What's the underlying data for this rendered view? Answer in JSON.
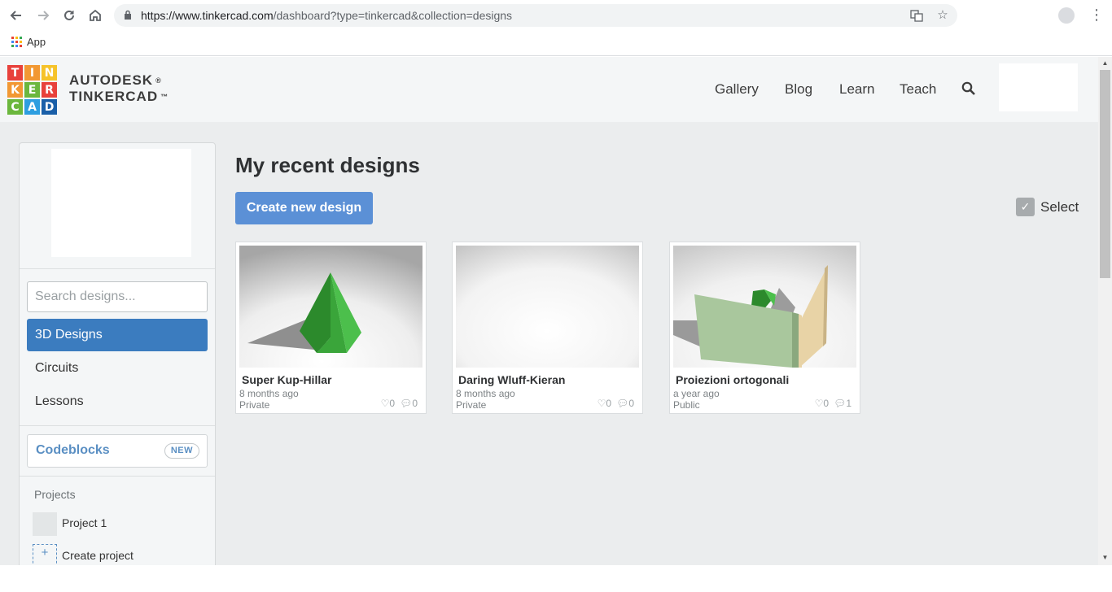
{
  "browser": {
    "url_host": "https://www.tinkercad.com",
    "url_path": "/dashboard?type=tinkercad&collection=designs",
    "bookmark_label": "App"
  },
  "header": {
    "logo_letters": [
      "T",
      "I",
      "N",
      "K",
      "E",
      "R",
      "C",
      "A",
      "D"
    ],
    "logo_colors": [
      "#e8413b",
      "#f29833",
      "#f6c32a",
      "#f29833",
      "#6bb73d",
      "#e8413b",
      "#6bb73d",
      "#2d9ee0",
      "#1a5fa8"
    ],
    "brand_line1": "AUTODESK",
    "brand_mark1": "®",
    "brand_line2": "TINKERCAD",
    "brand_mark2": "™",
    "nav": [
      "Gallery",
      "Blog",
      "Learn",
      "Teach"
    ]
  },
  "sidebar": {
    "search_placeholder": "Search designs...",
    "items": [
      {
        "label": "3D Designs",
        "active": true
      },
      {
        "label": "Circuits",
        "active": false
      },
      {
        "label": "Lessons",
        "active": false
      }
    ],
    "codeblocks_label": "Codeblocks",
    "codeblocks_badge": "NEW",
    "projects_title": "Projects",
    "project_name": "Project 1",
    "create_plus": "+",
    "create_label": "Create project"
  },
  "main": {
    "title": "My recent designs",
    "create_button": "Create new design",
    "select_label": "Select",
    "designs": [
      {
        "name": "Super Kup-Hillar",
        "time": "8 months ago",
        "visibility": "Private",
        "likes": "0",
        "comments": "0"
      },
      {
        "name": "Daring Wluff-Kieran",
        "time": "8 months ago",
        "visibility": "Private",
        "likes": "0",
        "comments": "0"
      },
      {
        "name": "Proiezioni ortogonali",
        "time": "a year ago",
        "visibility": "Public",
        "likes": "0",
        "comments": "1"
      }
    ]
  },
  "colors": {
    "accent_blue": "#3b7cbf",
    "button_blue": "#5b90d6",
    "shape_green": "#3aa53a",
    "panel_green": "#a9c79d",
    "panel_tan": "#e8d3a6"
  }
}
